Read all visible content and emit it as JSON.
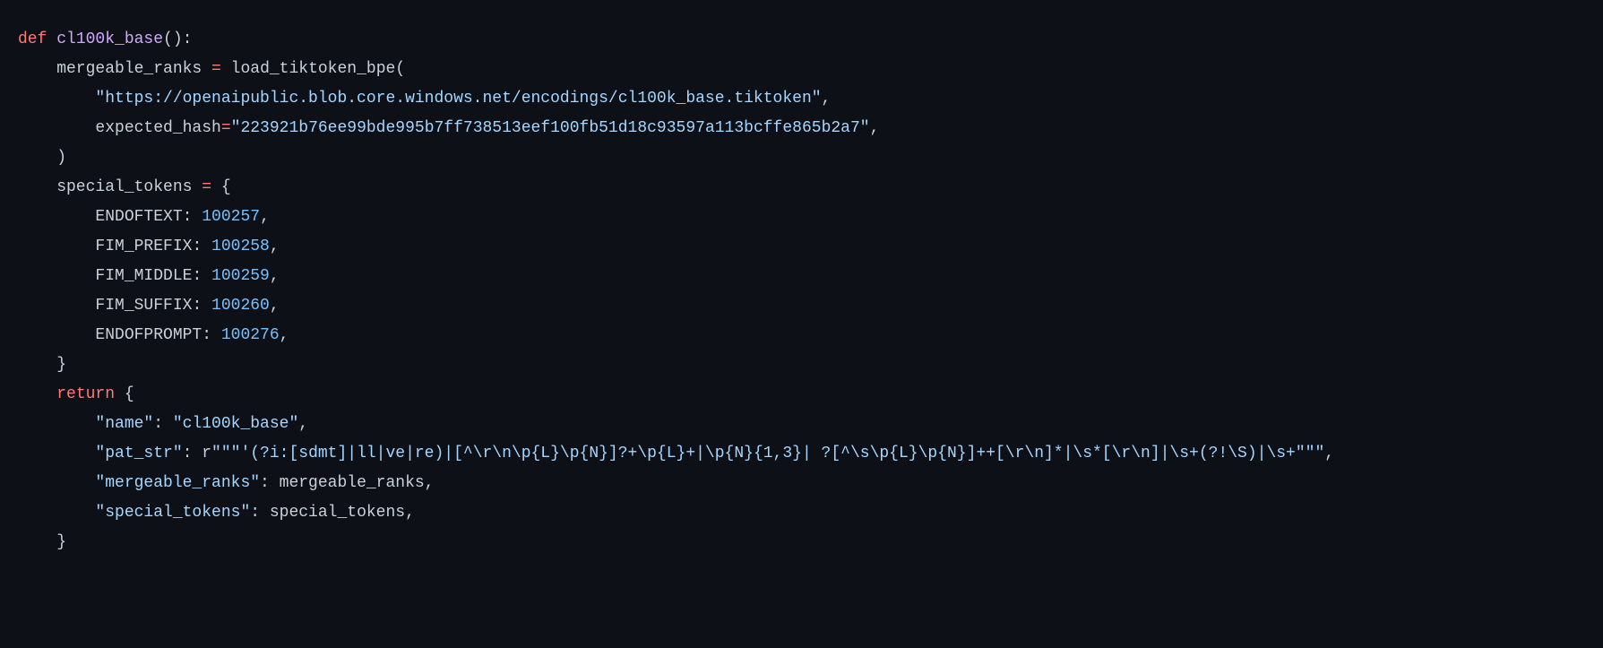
{
  "kw_def": "def",
  "fn_name": "cl100k_base",
  "paren_open_close": "():",
  "l2_a": "    mergeable_ranks ",
  "l2_b": "=",
  "l2_c": " load_tiktoken_bpe(",
  "l3_s": "        \"https://openaipublic.blob.core.windows.net/encodings/cl100k_base.tiktoken\"",
  "l3_p": ",",
  "l4_a": "        expected_hash",
  "l4_b": "=",
  "l4_s": "\"223921b76ee99bde995b7ff738513eef100fb51d18c93597a113bcffe865b2a7\"",
  "l4_p": ",",
  "l5": "    )",
  "l6_a": "    special_tokens ",
  "l6_b": "=",
  "l6_c": " {",
  "st1_k": "        ENDOFTEXT",
  "st1_c": ": ",
  "st1_v": "100257",
  "comma": ",",
  "st2_k": "        FIM_PREFIX",
  "st2_v": "100258",
  "st3_k": "        FIM_MIDDLE",
  "st3_v": "100259",
  "st4_k": "        FIM_SUFFIX",
  "st4_v": "100260",
  "st5_k": "        ENDOFPROMPT",
  "st5_v": "100276",
  "l12": "    }",
  "l13_a": "    ",
  "l13_kw": "return",
  "l13_b": " {",
  "r1_k": "        \"name\"",
  "r1_c": ": ",
  "r1_v": "\"cl100k_base\"",
  "r2_k": "        \"pat_str\"",
  "r2_c": ": r",
  "r2_v": "\"\"\"'(?i:[sdmt]|ll|ve|re)|[^\\r\\n\\p{L}\\p{N}]?+\\p{L}+|\\p{N}{1,3}| ?[^\\s\\p{L}\\p{N}]++[\\r\\n]*|\\s*[\\r\\n]|\\s+(?!\\S)|\\s+\"\"\"",
  "r3_k": "        \"mergeable_ranks\"",
  "r3_c": ": mergeable_ranks,",
  "r4_k": "        \"special_tokens\"",
  "r4_c": ": special_tokens,",
  "l18": "    }"
}
